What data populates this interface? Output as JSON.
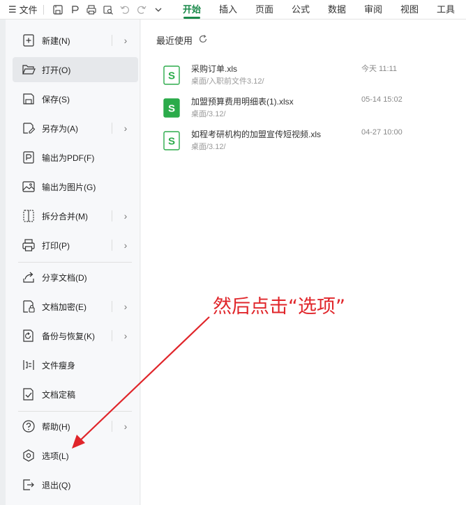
{
  "toolbar": {
    "menu_label": "文件",
    "tabs": [
      "开始",
      "插入",
      "页面",
      "公式",
      "数据",
      "审阅",
      "视图",
      "工具"
    ],
    "active_tab_index": 0,
    "accent_color": "#1b8a4b"
  },
  "file_menu": {
    "items": [
      {
        "label": "新建(N)",
        "icon": "new-file-icon",
        "submenu": true
      },
      {
        "label": "打开(O)",
        "icon": "folder-open-icon",
        "submenu": false,
        "selected": true
      },
      {
        "label": "保存(S)",
        "icon": "save-icon",
        "submenu": false
      },
      {
        "label": "另存为(A)",
        "icon": "save-as-icon",
        "submenu": true
      },
      {
        "label": "输出为PDF(F)",
        "icon": "export-pdf-icon",
        "submenu": false
      },
      {
        "label": "输出为图片(G)",
        "icon": "export-image-icon",
        "submenu": false
      },
      {
        "label": "拆分合并(M)",
        "icon": "split-merge-icon",
        "submenu": true
      },
      {
        "label": "打印(P)",
        "icon": "print-icon",
        "submenu": true
      },
      {
        "label": "分享文档(D)",
        "icon": "share-icon",
        "submenu": false
      },
      {
        "label": "文档加密(E)",
        "icon": "encrypt-icon",
        "submenu": true
      },
      {
        "label": "备份与恢复(K)",
        "icon": "backup-icon",
        "submenu": true
      },
      {
        "label": "文件瘦身",
        "icon": "slim-icon",
        "submenu": false
      },
      {
        "label": "文档定稿",
        "icon": "finalize-icon",
        "submenu": false
      },
      {
        "label": "帮助(H)",
        "icon": "help-icon",
        "submenu": true
      },
      {
        "label": "选项(L)",
        "icon": "options-icon",
        "submenu": false
      },
      {
        "label": "退出(Q)",
        "icon": "exit-icon",
        "submenu": false
      }
    ]
  },
  "recent": {
    "title": "最近使用",
    "files": [
      {
        "name": "采购订单.xls",
        "path": "桌面/入职前文件3.12/",
        "time": "今天 11:11",
        "icon": "spreadsheet-file-icon"
      },
      {
        "name": "加盟预算费用明细表(1).xlsx",
        "path": "桌面/3.12/",
        "time": "05-14 15:02",
        "icon": "spreadsheet-file-icon"
      },
      {
        "name": "如程考研机构的加盟宣传短视频.xls",
        "path": "桌面/3.12/",
        "time": "04-27 10:00",
        "icon": "spreadsheet-file-icon"
      }
    ]
  },
  "annotation": {
    "text": "然后点击“选项”",
    "color": "#e0252a"
  }
}
